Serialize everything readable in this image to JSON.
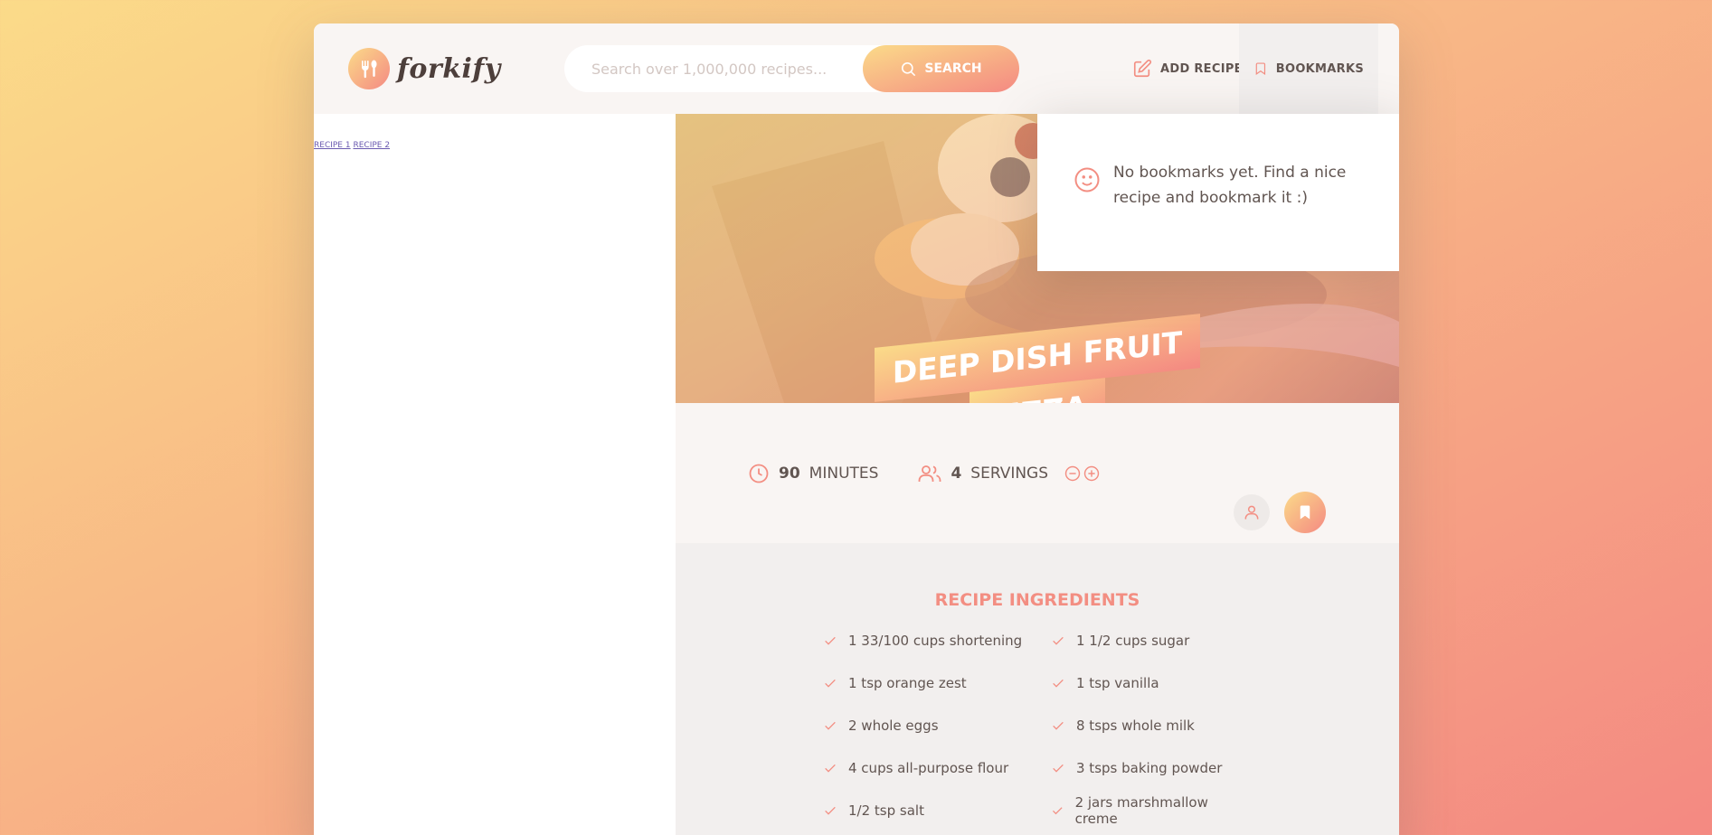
{
  "colors": {
    "accent": "#f38e82",
    "grad_start": "#fbdb89",
    "grad_end": "#f48982"
  },
  "logo": {
    "text": "forkify",
    "icon": "fork-spoon-icon"
  },
  "search": {
    "placeholder": "Search over 1,000,000 recipes...",
    "button_label": "SEARCH",
    "icon": "search-icon"
  },
  "nav": {
    "add_recipe": {
      "label": "ADD RECIPE",
      "icon": "edit-icon"
    },
    "bookmarks": {
      "label": "BOOKMARKS",
      "icon": "bookmark-icon"
    }
  },
  "sidebar": {
    "links": [
      {
        "label": "RECIPE 1"
      },
      {
        "label": "RECIPE 2"
      }
    ]
  },
  "recipe": {
    "title_line1": "DEEP DISH FRUIT",
    "title_line2": "PIZZA",
    "minutes_value": "90",
    "minutes_label": "MINUTES",
    "servings_value": "4",
    "servings_label": "SERVINGS"
  },
  "ingredients": {
    "title": "RECIPE INGREDIENTS",
    "items": [
      "1 33/100 cups shortening",
      "1 1/2 cups sugar",
      "1 tsp orange zest",
      "1 tsp vanilla",
      "2 whole eggs",
      "8 tsps whole milk",
      "4 cups all-purpose flour",
      "3 tsps baking powder",
      "1/2 tsp salt",
      "2 jars marshmallow creme"
    ]
  },
  "bookmarks_panel": {
    "message": "No bookmarks yet. Find a nice recipe and bookmark it :)",
    "icon": "smile-icon"
  }
}
